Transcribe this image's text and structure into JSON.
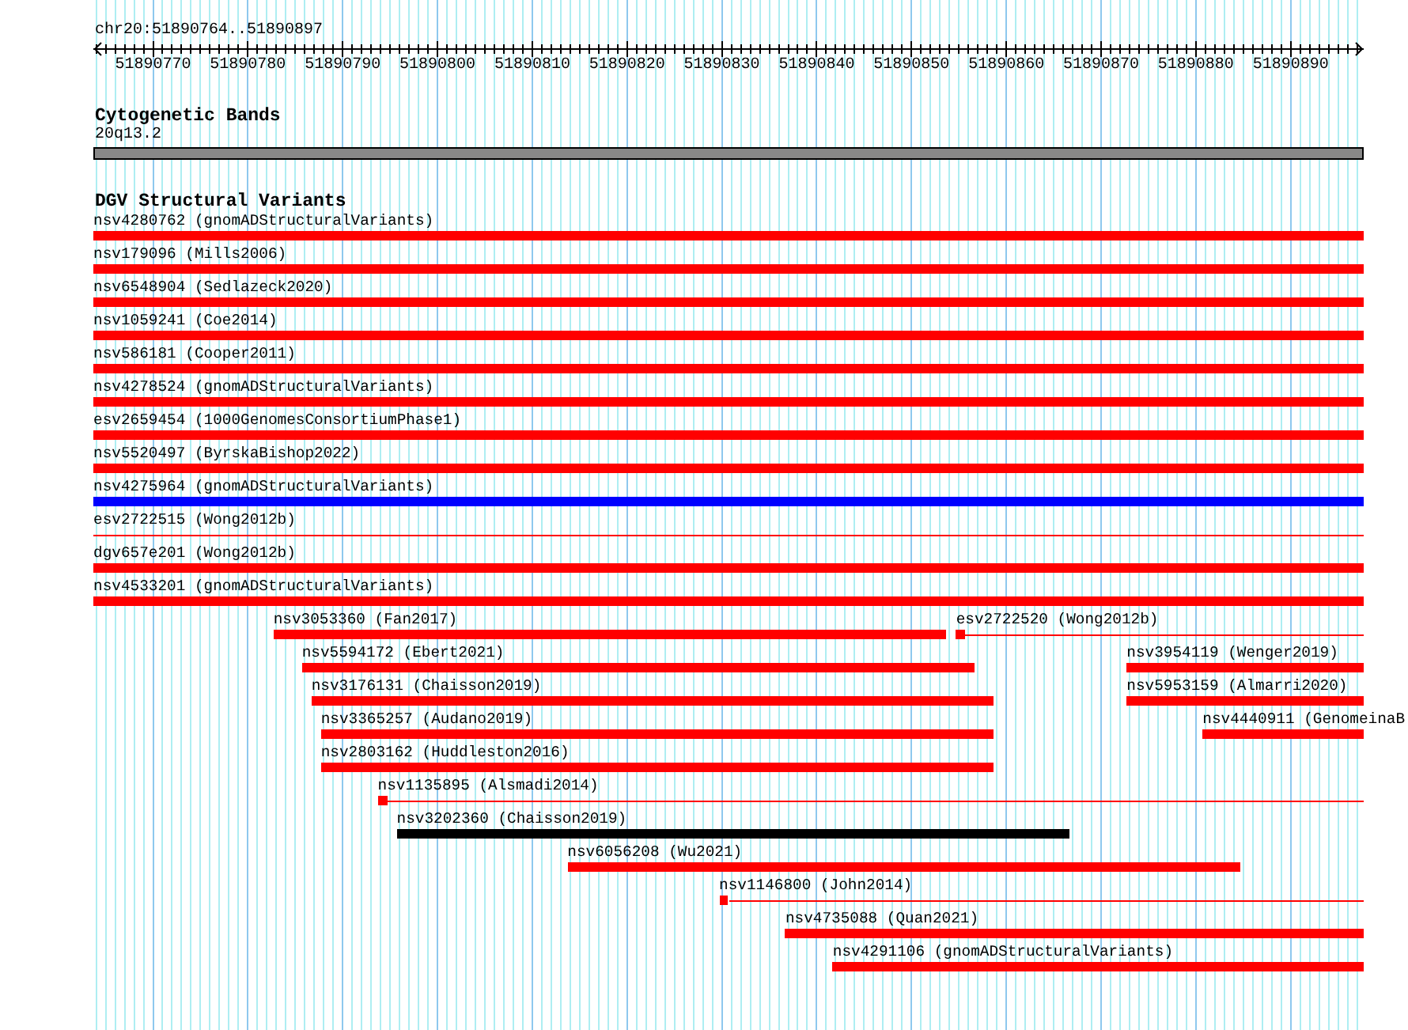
{
  "ruler": {
    "location": "chr20:51890764..51890897",
    "ticks": [
      "51890770",
      "51890780",
      "51890790",
      "51890800",
      "51890810",
      "51890820",
      "51890830",
      "51890840",
      "51890850",
      "51890860",
      "51890870",
      "51890880",
      "51890890"
    ]
  },
  "tracks": [
    {
      "kind": "bands",
      "title": "Cytogenetic Bands",
      "band": {
        "label": "20q13.2"
      }
    },
    {
      "kind": "features",
      "title": "DGV Structural Variants",
      "rows": [
        {
          "features": [
            {
              "label": "nsv4280762 (gnomADStructuralVariants)",
              "kind": "bar",
              "color": "#ff0000"
            }
          ]
        },
        {
          "features": [
            {
              "label": "nsv179096 (Mills2006)",
              "kind": "bar",
              "color": "#ff0000"
            }
          ]
        },
        {
          "features": [
            {
              "label": "nsv6548904 (Sedlazeck2020)",
              "kind": "bar",
              "color": "#ff0000"
            }
          ]
        },
        {
          "features": [
            {
              "label": "nsv1059241 (Coe2014)",
              "kind": "bar",
              "color": "#ff0000"
            }
          ]
        },
        {
          "features": [
            {
              "label": "nsv586181 (Cooper2011)",
              "kind": "bar",
              "color": "#ff0000"
            }
          ]
        },
        {
          "features": [
            {
              "label": "nsv4278524 (gnomADStructuralVariants)",
              "kind": "bar",
              "color": "#ff0000"
            }
          ]
        },
        {
          "features": [
            {
              "label": "esv2659454 (1000GenomesConsortiumPhase1)",
              "kind": "bar",
              "color": "#ff0000"
            }
          ]
        },
        {
          "features": [
            {
              "label": "nsv5520497 (ByrskaBishop2022)",
              "kind": "bar",
              "color": "#ff0000"
            }
          ]
        },
        {
          "features": [
            {
              "label": "nsv4275964 (gnomADStructuralVariants)",
              "kind": "bar",
              "color": "#0000ff"
            }
          ]
        },
        {
          "features": [
            {
              "label": "esv2722515 (Wong2012b)",
              "kind": "line",
              "color": "#ff0000"
            }
          ]
        },
        {
          "features": [
            {
              "label": "dgv657e201 (Wong2012b)",
              "kind": "bar",
              "color": "#ff0000"
            }
          ]
        },
        {
          "features": [
            {
              "label": "nsv4533201 (gnomADStructuralVariants)",
              "kind": "bar",
              "color": "#ff0000"
            }
          ]
        },
        {
          "features": [
            {
              "label": "nsv3053360 (Fan2017)",
              "kind": "bar",
              "color": "#ff0000"
            },
            {
              "label": "esv2722520 (Wong2012b)",
              "kind": "line",
              "color": "#ff0000"
            }
          ]
        },
        {
          "features": [
            {
              "label": "nsv5594172 (Ebert2021)",
              "kind": "bar",
              "color": "#ff0000"
            },
            {
              "label": "nsv3954119 (Wenger2019)",
              "kind": "bar",
              "color": "#ff0000"
            }
          ]
        },
        {
          "features": [
            {
              "label": "nsv3176131 (Chaisson2019)",
              "kind": "bar",
              "color": "#ff0000"
            },
            {
              "label": "nsv5953159 (Almarri2020)",
              "kind": "bar",
              "color": "#ff0000"
            }
          ]
        },
        {
          "features": [
            {
              "label": "nsv3365257 (Audano2019)",
              "kind": "bar",
              "color": "#ff0000"
            },
            {
              "label": "nsv4440911 (GenomeinaB",
              "kind": "bar",
              "color": "#ff0000"
            }
          ]
        },
        {
          "features": [
            {
              "label": "nsv2803162 (Huddleston2016)",
              "kind": "bar",
              "color": "#ff0000"
            }
          ]
        },
        {
          "features": [
            {
              "label": "nsv1135895 (Alsmadi2014)",
              "kind": "line",
              "color": "#ff0000"
            }
          ]
        },
        {
          "features": [
            {
              "label": "nsv3202360 (Chaisson2019)",
              "kind": "bar",
              "color": "#000000"
            }
          ]
        },
        {
          "features": [
            {
              "label": "nsv6056208 (Wu2021)",
              "kind": "bar",
              "color": "#ff0000"
            }
          ]
        },
        {
          "features": [
            {
              "label": "nsv1146800 (John2014)",
              "kind": "line",
              "color": "#ff0000"
            }
          ]
        },
        {
          "features": [
            {
              "label": "nsv4735088 (Quan2021)",
              "kind": "bar",
              "color": "#ff0000"
            }
          ]
        },
        {
          "features": [
            {
              "label": "nsv4291106 (gnomADStructuralVariants)",
              "kind": "bar",
              "color": "#ff0000"
            }
          ]
        }
      ]
    }
  ]
}
